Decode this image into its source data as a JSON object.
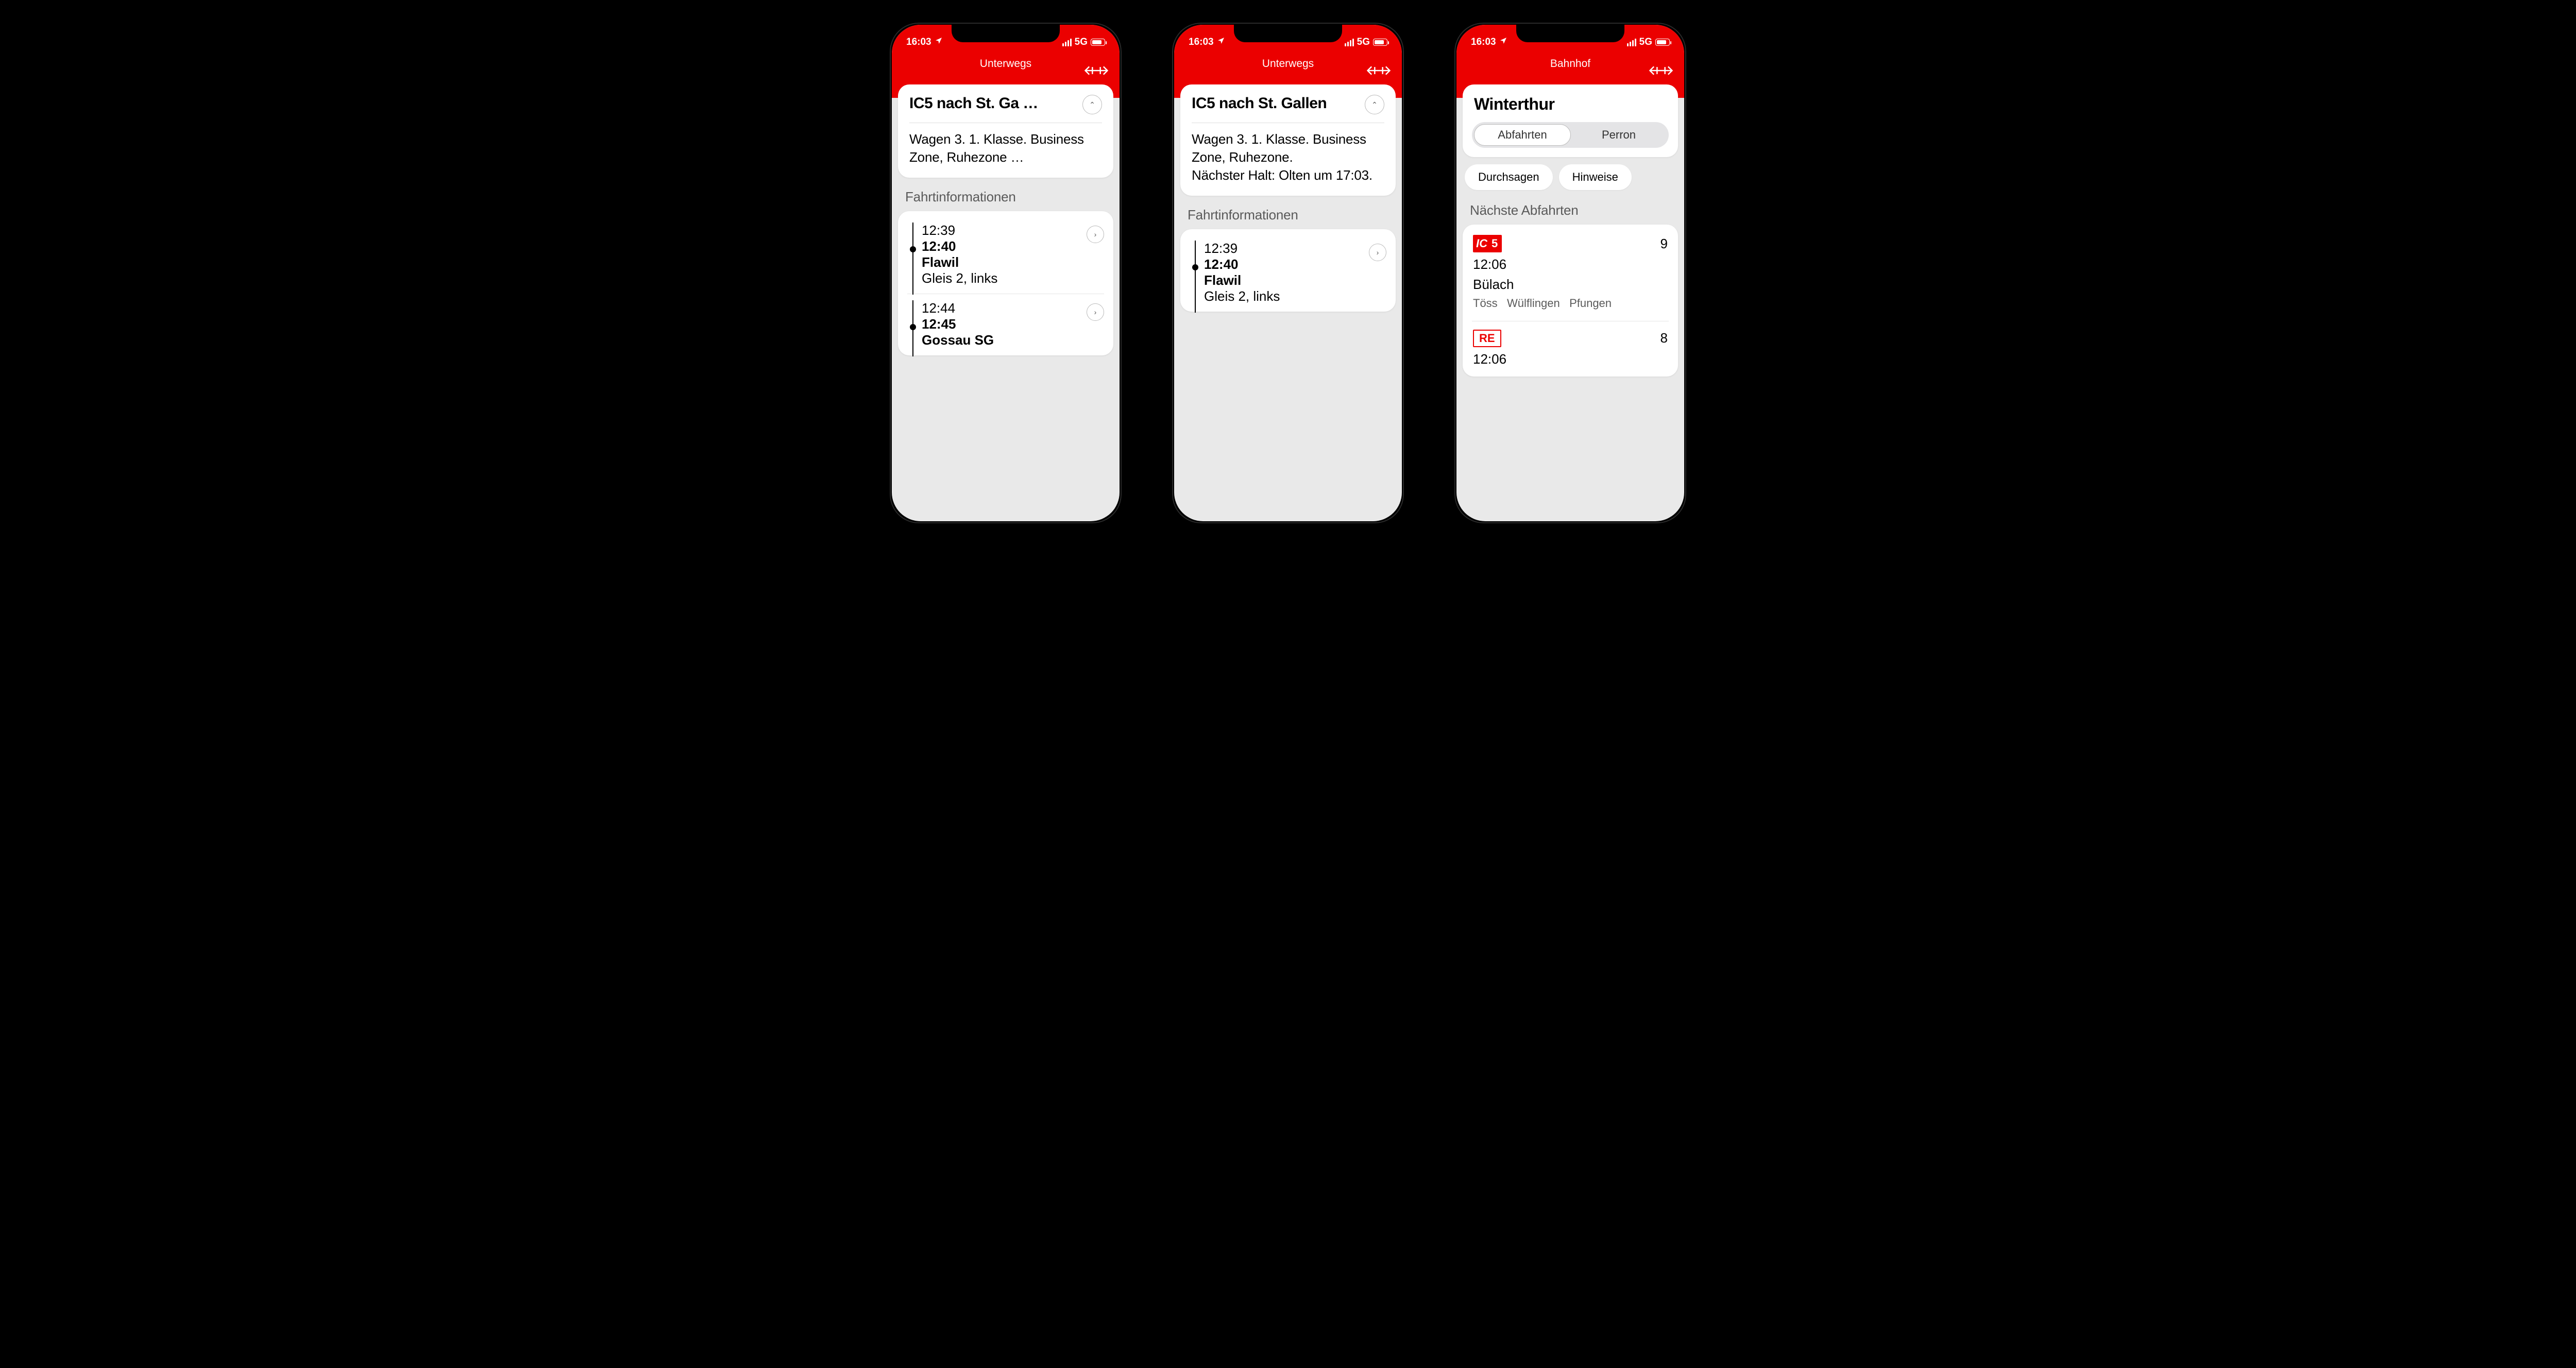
{
  "status": {
    "time": "16:03",
    "network": "5G"
  },
  "screen1": {
    "title": "Unterwegs",
    "card": {
      "heading": "IC5 nach St. Ga …",
      "body": "Wagen 3. 1. Klasse. Business Zone, Ruhezone …"
    },
    "section_label": "Fahrtinformationen",
    "stops": [
      {
        "arr": "12:39",
        "dep": "12:40",
        "name": "Flawil",
        "track": "Gleis 2, links"
      },
      {
        "arr": "12:44",
        "dep": "12:45",
        "name": "Gossau SG",
        "track": ""
      }
    ]
  },
  "screen2": {
    "title": "Unterwegs",
    "card": {
      "heading": "IC5 nach St. Gallen",
      "body": "Wagen 3. 1. Klasse. Business Zone, Ruhezone.\nNächster Halt: Olten um 17:03."
    },
    "section_label": "Fahrtinformationen",
    "stops": [
      {
        "arr": "12:39",
        "dep": "12:40",
        "name": "Flawil",
        "track": "Gleis 2, links"
      }
    ]
  },
  "screen3": {
    "title": "Bahnhof",
    "station": "Winterthur",
    "segments": {
      "a": "Abfahrten",
      "b": "Perron"
    },
    "chips": {
      "a": "Durchsagen",
      "b": "Hinweise"
    },
    "section_label": "Nächste Abfahrten",
    "departures": [
      {
        "line_type": "IC",
        "line_num": "5",
        "badge_style": "solid",
        "platform": "9",
        "time": "12:06",
        "destination": "Bülach",
        "via": "Töss   Wülflingen   Pfungen"
      },
      {
        "line_type": "RE",
        "line_num": "",
        "badge_style": "outline",
        "platform": "8",
        "time": "12:06",
        "destination": "",
        "via": ""
      }
    ]
  }
}
